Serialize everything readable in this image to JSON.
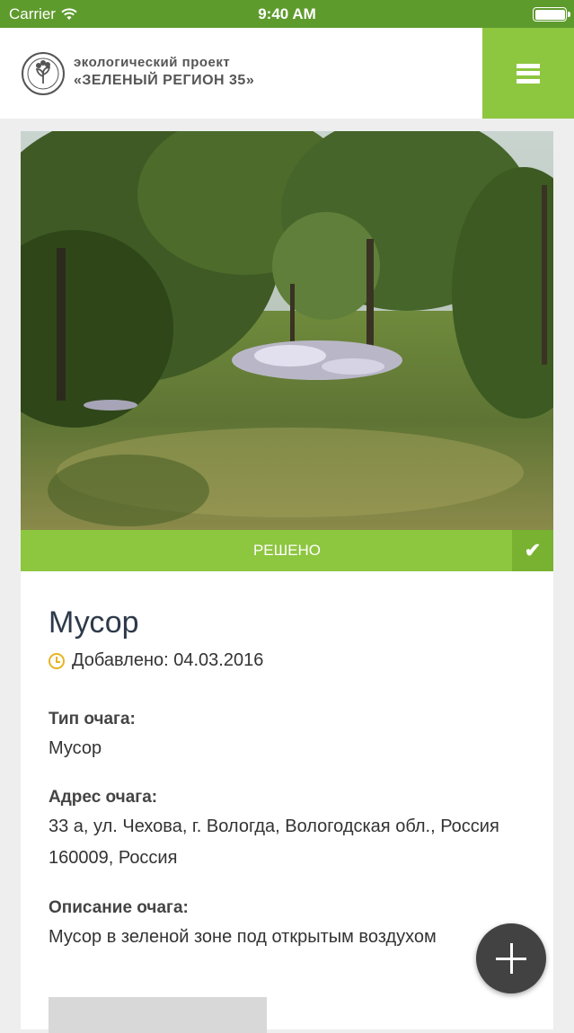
{
  "status_bar": {
    "carrier": "Carrier",
    "time": "9:40 AM"
  },
  "header": {
    "brand_line1": "экологический проект",
    "brand_line2": "«ЗЕЛЕНЫЙ РЕГИОН 35»"
  },
  "report": {
    "status": "РЕШЕНО",
    "title": "Мусор",
    "added": "Добавлено: 04.03.2016",
    "fields": [
      {
        "label": "Тип очага:",
        "value": "Мусор"
      },
      {
        "label": "Адрес очага:",
        "value": "33 а, ул. Чехова, г. Вологда, Вологодская обл., Россия 160009, Россия"
      },
      {
        "label": "Описание очага:",
        "value": "Мусор в зеленой зоне под открытым воздухом"
      }
    ]
  },
  "colors": {
    "accent": "#8dc63f",
    "status_bar": "#5e9b2d",
    "fab": "#424242"
  },
  "icons": {
    "menu": "hamburger-icon",
    "check": "checkmark-icon",
    "clock": "clock-icon",
    "add": "plus-icon",
    "wifi": "wifi-icon",
    "battery": "battery-icon"
  }
}
